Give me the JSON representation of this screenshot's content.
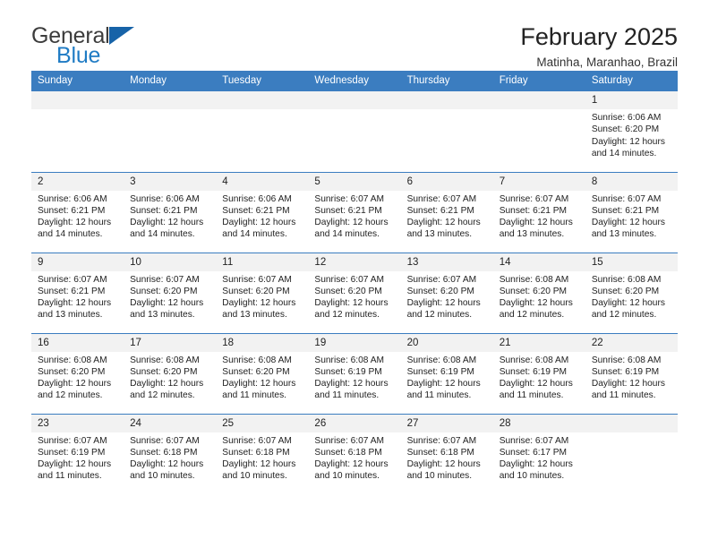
{
  "brand": {
    "name_part1": "General",
    "name_part2": "Blue",
    "accent_color": "#1f7bc4",
    "triangle_color": "#1763a8"
  },
  "header": {
    "title": "February 2025",
    "subtitle": "Matinha, Maranhao, Brazil"
  },
  "theme": {
    "header_blue": "#3b7dc0",
    "daynum_band": "#f2f2f2",
    "text": "#222222"
  },
  "weekdays": [
    "Sunday",
    "Monday",
    "Tuesday",
    "Wednesday",
    "Thursday",
    "Friday",
    "Saturday"
  ],
  "labels": {
    "sunrise_prefix": "Sunrise:",
    "sunset_prefix": "Sunset:",
    "daylight_prefix": "Daylight:"
  },
  "weeks": [
    [
      {
        "day": "",
        "empty": true
      },
      {
        "day": "",
        "empty": true
      },
      {
        "day": "",
        "empty": true
      },
      {
        "day": "",
        "empty": true
      },
      {
        "day": "",
        "empty": true
      },
      {
        "day": "",
        "empty": true
      },
      {
        "day": "1",
        "sunrise": "Sunrise: 6:06 AM",
        "sunset": "Sunset: 6:20 PM",
        "daylight1": "Daylight: 12 hours",
        "daylight2": "and 14 minutes."
      }
    ],
    [
      {
        "day": "2",
        "sunrise": "Sunrise: 6:06 AM",
        "sunset": "Sunset: 6:21 PM",
        "daylight1": "Daylight: 12 hours",
        "daylight2": "and 14 minutes."
      },
      {
        "day": "3",
        "sunrise": "Sunrise: 6:06 AM",
        "sunset": "Sunset: 6:21 PM",
        "daylight1": "Daylight: 12 hours",
        "daylight2": "and 14 minutes."
      },
      {
        "day": "4",
        "sunrise": "Sunrise: 6:06 AM",
        "sunset": "Sunset: 6:21 PM",
        "daylight1": "Daylight: 12 hours",
        "daylight2": "and 14 minutes."
      },
      {
        "day": "5",
        "sunrise": "Sunrise: 6:07 AM",
        "sunset": "Sunset: 6:21 PM",
        "daylight1": "Daylight: 12 hours",
        "daylight2": "and 14 minutes."
      },
      {
        "day": "6",
        "sunrise": "Sunrise: 6:07 AM",
        "sunset": "Sunset: 6:21 PM",
        "daylight1": "Daylight: 12 hours",
        "daylight2": "and 13 minutes."
      },
      {
        "day": "7",
        "sunrise": "Sunrise: 6:07 AM",
        "sunset": "Sunset: 6:21 PM",
        "daylight1": "Daylight: 12 hours",
        "daylight2": "and 13 minutes."
      },
      {
        "day": "8",
        "sunrise": "Sunrise: 6:07 AM",
        "sunset": "Sunset: 6:21 PM",
        "daylight1": "Daylight: 12 hours",
        "daylight2": "and 13 minutes."
      }
    ],
    [
      {
        "day": "9",
        "sunrise": "Sunrise: 6:07 AM",
        "sunset": "Sunset: 6:21 PM",
        "daylight1": "Daylight: 12 hours",
        "daylight2": "and 13 minutes."
      },
      {
        "day": "10",
        "sunrise": "Sunrise: 6:07 AM",
        "sunset": "Sunset: 6:20 PM",
        "daylight1": "Daylight: 12 hours",
        "daylight2": "and 13 minutes."
      },
      {
        "day": "11",
        "sunrise": "Sunrise: 6:07 AM",
        "sunset": "Sunset: 6:20 PM",
        "daylight1": "Daylight: 12 hours",
        "daylight2": "and 13 minutes."
      },
      {
        "day": "12",
        "sunrise": "Sunrise: 6:07 AM",
        "sunset": "Sunset: 6:20 PM",
        "daylight1": "Daylight: 12 hours",
        "daylight2": "and 12 minutes."
      },
      {
        "day": "13",
        "sunrise": "Sunrise: 6:07 AM",
        "sunset": "Sunset: 6:20 PM",
        "daylight1": "Daylight: 12 hours",
        "daylight2": "and 12 minutes."
      },
      {
        "day": "14",
        "sunrise": "Sunrise: 6:08 AM",
        "sunset": "Sunset: 6:20 PM",
        "daylight1": "Daylight: 12 hours",
        "daylight2": "and 12 minutes."
      },
      {
        "day": "15",
        "sunrise": "Sunrise: 6:08 AM",
        "sunset": "Sunset: 6:20 PM",
        "daylight1": "Daylight: 12 hours",
        "daylight2": "and 12 minutes."
      }
    ],
    [
      {
        "day": "16",
        "sunrise": "Sunrise: 6:08 AM",
        "sunset": "Sunset: 6:20 PM",
        "daylight1": "Daylight: 12 hours",
        "daylight2": "and 12 minutes."
      },
      {
        "day": "17",
        "sunrise": "Sunrise: 6:08 AM",
        "sunset": "Sunset: 6:20 PM",
        "daylight1": "Daylight: 12 hours",
        "daylight2": "and 12 minutes."
      },
      {
        "day": "18",
        "sunrise": "Sunrise: 6:08 AM",
        "sunset": "Sunset: 6:20 PM",
        "daylight1": "Daylight: 12 hours",
        "daylight2": "and 11 minutes."
      },
      {
        "day": "19",
        "sunrise": "Sunrise: 6:08 AM",
        "sunset": "Sunset: 6:19 PM",
        "daylight1": "Daylight: 12 hours",
        "daylight2": "and 11 minutes."
      },
      {
        "day": "20",
        "sunrise": "Sunrise: 6:08 AM",
        "sunset": "Sunset: 6:19 PM",
        "daylight1": "Daylight: 12 hours",
        "daylight2": "and 11 minutes."
      },
      {
        "day": "21",
        "sunrise": "Sunrise: 6:08 AM",
        "sunset": "Sunset: 6:19 PM",
        "daylight1": "Daylight: 12 hours",
        "daylight2": "and 11 minutes."
      },
      {
        "day": "22",
        "sunrise": "Sunrise: 6:08 AM",
        "sunset": "Sunset: 6:19 PM",
        "daylight1": "Daylight: 12 hours",
        "daylight2": "and 11 minutes."
      }
    ],
    [
      {
        "day": "23",
        "sunrise": "Sunrise: 6:07 AM",
        "sunset": "Sunset: 6:19 PM",
        "daylight1": "Daylight: 12 hours",
        "daylight2": "and 11 minutes."
      },
      {
        "day": "24",
        "sunrise": "Sunrise: 6:07 AM",
        "sunset": "Sunset: 6:18 PM",
        "daylight1": "Daylight: 12 hours",
        "daylight2": "and 10 minutes."
      },
      {
        "day": "25",
        "sunrise": "Sunrise: 6:07 AM",
        "sunset": "Sunset: 6:18 PM",
        "daylight1": "Daylight: 12 hours",
        "daylight2": "and 10 minutes."
      },
      {
        "day": "26",
        "sunrise": "Sunrise: 6:07 AM",
        "sunset": "Sunset: 6:18 PM",
        "daylight1": "Daylight: 12 hours",
        "daylight2": "and 10 minutes."
      },
      {
        "day": "27",
        "sunrise": "Sunrise: 6:07 AM",
        "sunset": "Sunset: 6:18 PM",
        "daylight1": "Daylight: 12 hours",
        "daylight2": "and 10 minutes."
      },
      {
        "day": "28",
        "sunrise": "Sunrise: 6:07 AM",
        "sunset": "Sunset: 6:17 PM",
        "daylight1": "Daylight: 12 hours",
        "daylight2": "and 10 minutes."
      },
      {
        "day": "",
        "empty": true
      }
    ]
  ]
}
